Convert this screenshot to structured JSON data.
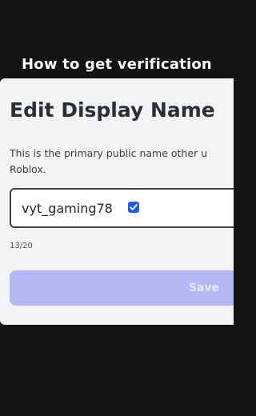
{
  "caption": "How to get verification",
  "dialog": {
    "title": "Edit Display Name",
    "description_line1": "This is the primary public name other u",
    "description_line2": "Roblox.",
    "display_name_value": "vyt_gaming78",
    "verified_icon": "verified-checkmark-icon",
    "character_count": "13/20",
    "save_label": "Save"
  },
  "colors": {
    "background": "#141414",
    "dialog_background": "#f2f3f5",
    "save_button": "#b5b7f5",
    "verified_badge": "#1e5cf0"
  }
}
